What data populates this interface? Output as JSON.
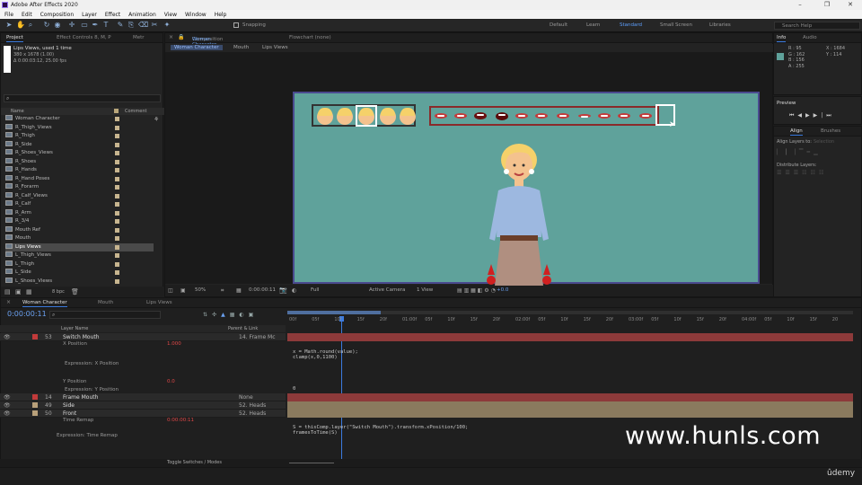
{
  "window": {
    "title": "Adobe After Effects 2020",
    "controls": [
      "–",
      "❐",
      "✕"
    ]
  },
  "menu": [
    "File",
    "Edit",
    "Composition",
    "Layer",
    "Effect",
    "Animation",
    "View",
    "Window",
    "Help"
  ],
  "toolbar": {
    "snapping_label": "Snapping",
    "workspaces": [
      "Default",
      "Learn",
      "Standard",
      "Small Screen",
      "Libraries"
    ],
    "active_workspace": "Standard",
    "search_placeholder": "Search Help"
  },
  "project_panel": {
    "tabs": [
      "Project",
      "Effect Controls 8, M, P",
      "Metr"
    ],
    "selected_item_name": "Lips Views",
    "selected_item_usage": ", used 1 time",
    "selected_item_dims": "380 x 1678 (1.00)",
    "selected_item_duration": "Δ 0:00:03:12, 25.00 fps",
    "search_icon": "search-icon",
    "col_name": "Name",
    "col_comment": "Comment",
    "items": [
      "Woman Character",
      "R_Thigh_Views",
      "R_Thigh",
      "R_Side",
      "R_Shoes_Views",
      "R_Shoes",
      "R_Hands",
      "R_Hand Poses",
      "R_Forarm",
      "R_Calf_Views",
      "R_Calf",
      "R_Arm",
      "R_3/4",
      "Mouth Ref",
      "Mouth",
      "Lips Views",
      "L_Thigh_Views",
      "L_Thigh",
      "L_Side",
      "L_Shoes_Views"
    ],
    "selected_index": 15,
    "bpc": "8 bpc"
  },
  "composition_panel": {
    "tab_prefix": "Composition",
    "tab_comp": "Woman Character",
    "flowchart_tab": "Flowchart (none)",
    "breadcrumbs": [
      "Woman Character",
      "Mouth",
      "Lips Views"
    ],
    "zoom": "50%",
    "timecode": "0:00:00:11",
    "resolution": "Full",
    "camera": "Active Camera",
    "views": "1 View",
    "exposure": "+0.0"
  },
  "info_panel": {
    "tabs": [
      "Info",
      "Audio"
    ],
    "r": "R : 95",
    "g": "G : 162",
    "b": "B : 156",
    "a": "A : 255",
    "x": "X : 1684",
    "y": "Y : 114",
    "swatch_color": "#5fa29b"
  },
  "preview_panel": {
    "title": "Preview",
    "controls": [
      "first-frame",
      "prev-frame",
      "play",
      "next-frame",
      "last-frame"
    ]
  },
  "align_panel": {
    "tabs": [
      "Align",
      "Brushes"
    ],
    "align_layers_to": "Align Layers to:",
    "align_to_value": "Selection",
    "distribute_layers": "Distribute Layers:"
  },
  "timeline": {
    "tabs": [
      "Woman Character",
      "Mouth",
      "Lips Views"
    ],
    "timecode": "0:00:00:11",
    "header_layer_name": "Layer Name",
    "header_parent": "Parent & Link",
    "ruler_labels": [
      "00f",
      "05f",
      "10f",
      "15f",
      "20f",
      "01:00f",
      "05f",
      "10f",
      "15f",
      "20f",
      "02:00f",
      "05f",
      "10f",
      "15f",
      "20f",
      "03:00f",
      "05f",
      "10f",
      "15f",
      "20f",
      "04:00f",
      "05f",
      "10f",
      "15f",
      "20"
    ],
    "rows": [
      {
        "num": "53",
        "name": "Switch Mouth",
        "parent": "14. Frame Mc",
        "type": "layer"
      },
      {
        "label": "X Position",
        "value": "1.000",
        "type": "prop"
      },
      {
        "label": "Expression: X Position",
        "type": "expr"
      },
      {
        "label": "Y Position",
        "value": "0.0",
        "type": "prop"
      },
      {
        "label": "Expression: Y Position",
        "type": "expr"
      },
      {
        "num": "14",
        "name": "Frame Mouth",
        "parent": "None",
        "type": "layer"
      },
      {
        "num": "49",
        "name": "Side",
        "parent": "52. Heads",
        "type": "layer"
      },
      {
        "num": "50",
        "name": "Front",
        "parent": "52. Heads",
        "type": "layer"
      },
      {
        "label": "Time Remap",
        "value": "0:00:00:11",
        "type": "prop"
      },
      {
        "label": "Expression: Time Remap",
        "type": "expr"
      }
    ],
    "expr_x": "x = Math.round(value);\nclamp(x,0,1100)",
    "expr_y": "0",
    "expr_time": "S = thisComp.layer(\"Switch Mouth\").transform.xPosition/100;\nframesToTime(S)",
    "toggle_label": "Toggle Switches / Modes"
  },
  "watermark": "www.hunls.com",
  "udemy": "ûdemy"
}
